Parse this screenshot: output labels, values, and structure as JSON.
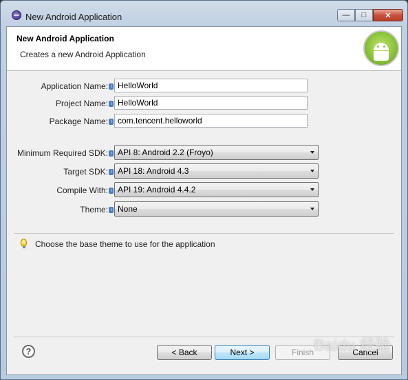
{
  "window": {
    "title": "New Android Application",
    "minimize_glyph": "—",
    "maximize_glyph": "□",
    "close_glyph": "✕"
  },
  "header": {
    "title": "New Android Application",
    "subtitle": "Creates a new Android Application"
  },
  "fields": {
    "application_name_label": "Application Name:",
    "application_name_value": "HelloWorld",
    "project_name_label": "Project Name:",
    "project_name_value": "HelloWorld",
    "package_name_label": "Package Name:",
    "package_name_value": "com.tencent.helloworld"
  },
  "sdk": {
    "min_sdk_label": "Minimum Required SDK:",
    "min_sdk_value": "API 8: Android 2.2 (Froyo)",
    "target_sdk_label": "Target SDK:",
    "target_sdk_value": "API 18: Android 4.3",
    "compile_with_label": "Compile With:",
    "compile_with_value": "API 19: Android 4.4.2",
    "theme_label": "Theme:",
    "theme_value": "None"
  },
  "hint": "Choose the base theme to use for the application",
  "buttons": {
    "help": "?",
    "back": "< Back",
    "next": "Next >",
    "finish": "Finish",
    "cancel": "Cancel"
  },
  "watermark": "Baidu 经验",
  "colors": {
    "android_green": "#8cc43c",
    "default_button_border": "#3c7fb1"
  }
}
